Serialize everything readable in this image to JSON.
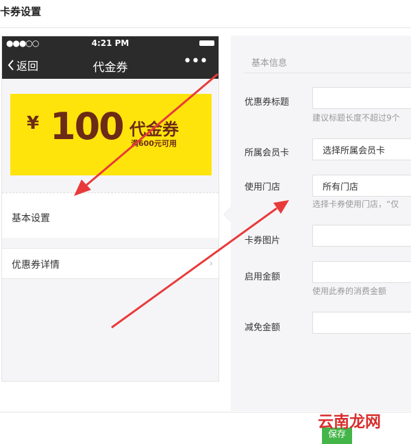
{
  "page": {
    "title": "卡券设置"
  },
  "phone": {
    "status_signal": "●●●○○",
    "status_time": "4:21 PM",
    "back_label": "返回",
    "nav_title": "代金券",
    "more_label": "•••",
    "coupon": {
      "currency": "¥",
      "amount": "100",
      "name": "代金券",
      "condition": "满600元可用",
      "bg_color": "#ffe40c",
      "text_color": "#6b2b16"
    },
    "menu": [
      {
        "label": "基本设置"
      },
      {
        "label": "优惠券详情"
      }
    ]
  },
  "form": {
    "section_title": "基本信息",
    "fields": [
      {
        "label": "优惠券标题",
        "value": "",
        "hint": "建议标题长度不超过9个"
      },
      {
        "label": "所属会员卡",
        "value": "选择所属会员卡",
        "hint": ""
      },
      {
        "label": "使用门店",
        "value": "所有门店",
        "hint": "选择卡券使用门店，“仅"
      },
      {
        "label": "卡券图片",
        "value": "",
        "hint": ""
      },
      {
        "label": "启用金额",
        "value": "",
        "hint": "使用此券的消费金额"
      },
      {
        "label": "减免金额",
        "value": "",
        "hint": ""
      }
    ]
  },
  "footer": {
    "save_label": "保存",
    "accent_color": "#44b549"
  },
  "watermark": "云南龙网",
  "annotation_color": "#e83a3a"
}
